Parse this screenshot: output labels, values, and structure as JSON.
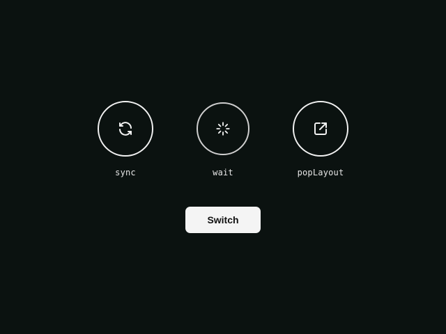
{
  "modes": [
    {
      "label": "sync",
      "icon": "sync-icon"
    },
    {
      "label": "wait",
      "icon": "spinner-icon"
    },
    {
      "label": "popLayout",
      "icon": "external-link-icon"
    }
  ],
  "switch_button": {
    "label": "Switch"
  },
  "colors": {
    "background": "#0b1210",
    "ring": "#f2f2f2",
    "button_bg": "#f4f4f4",
    "button_text": "#111111"
  }
}
